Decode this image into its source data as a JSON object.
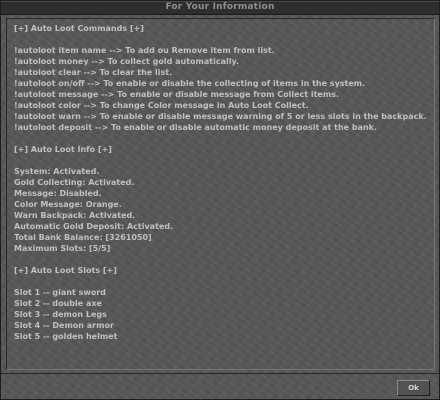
{
  "window": {
    "title": "For Your Information"
  },
  "sections": [
    {
      "lines": [
        "[+] Auto Loot Commands [+]",
        "",
        "!autoloot item name --> To add ou Remove item from list.",
        "!autoloot money --> To collect gold automatically.",
        "!autoloot clear --> To clear the list.",
        "!autoloot on/off --> To enable or disable the collecting of items in the system.",
        "!autoloot message --> To enable or disable message from Collect items.",
        "!autoloot color --> To change Color message in Auto Loot Collect.",
        "!autoloot warn --> To enable or disable message warning of 5 or less slots in the backpack.",
        "!autoloot deposit --> To enable or disable automatic money deposit at the bank.",
        "",
        "[+] Auto Loot Info [+]",
        "",
        "System: Activated.",
        "Gold Collecting: Activated.",
        "Message: Disabled.",
        "Color Message: Orange.",
        "Warn Backpack: Activated.",
        "Automatic Gold Deposit: Activated.",
        "Total Bank Balance: [3261050]",
        "Maximum Slots: [5/5]",
        "",
        "[+] Auto Loot Slots [+]",
        "",
        "Slot 1 -- giant sword",
        "Slot 2 -- double axe",
        "Slot 3 -- demon Legs",
        "Slot 4 -- Demon armor",
        "Slot 5 -- golden helmet"
      ]
    }
  ],
  "footer": {
    "ok_label": "Ok"
  }
}
